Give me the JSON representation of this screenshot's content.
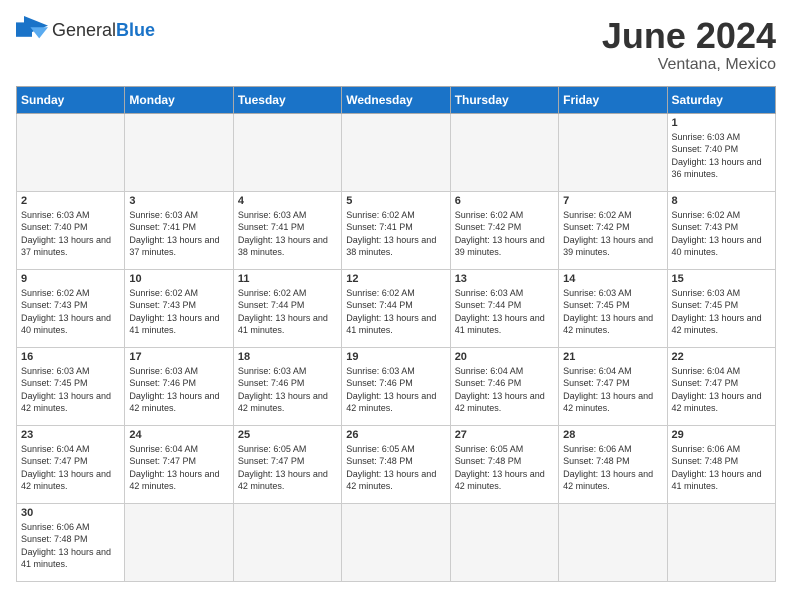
{
  "header": {
    "logo_general": "General",
    "logo_blue": "Blue",
    "month_year": "June 2024",
    "location": "Ventana, Mexico"
  },
  "weekdays": [
    "Sunday",
    "Monday",
    "Tuesday",
    "Wednesday",
    "Thursday",
    "Friday",
    "Saturday"
  ],
  "weeks": [
    [
      {
        "day": "",
        "text": "",
        "empty": true
      },
      {
        "day": "",
        "text": "",
        "empty": true
      },
      {
        "day": "",
        "text": "",
        "empty": true
      },
      {
        "day": "",
        "text": "",
        "empty": true
      },
      {
        "day": "",
        "text": "",
        "empty": true
      },
      {
        "day": "",
        "text": "",
        "empty": true
      },
      {
        "day": "1",
        "text": "Sunrise: 6:03 AM\nSunset: 7:40 PM\nDaylight: 13 hours and 36 minutes."
      }
    ],
    [
      {
        "day": "2",
        "text": "Sunrise: 6:03 AM\nSunset: 7:40 PM\nDaylight: 13 hours and 37 minutes."
      },
      {
        "day": "3",
        "text": "Sunrise: 6:03 AM\nSunset: 7:41 PM\nDaylight: 13 hours and 37 minutes."
      },
      {
        "day": "4",
        "text": "Sunrise: 6:03 AM\nSunset: 7:41 PM\nDaylight: 13 hours and 38 minutes."
      },
      {
        "day": "5",
        "text": "Sunrise: 6:02 AM\nSunset: 7:41 PM\nDaylight: 13 hours and 38 minutes."
      },
      {
        "day": "6",
        "text": "Sunrise: 6:02 AM\nSunset: 7:42 PM\nDaylight: 13 hours and 39 minutes."
      },
      {
        "day": "7",
        "text": "Sunrise: 6:02 AM\nSunset: 7:42 PM\nDaylight: 13 hours and 39 minutes."
      },
      {
        "day": "8",
        "text": "Sunrise: 6:02 AM\nSunset: 7:43 PM\nDaylight: 13 hours and 40 minutes."
      }
    ],
    [
      {
        "day": "9",
        "text": "Sunrise: 6:02 AM\nSunset: 7:43 PM\nDaylight: 13 hours and 40 minutes."
      },
      {
        "day": "10",
        "text": "Sunrise: 6:02 AM\nSunset: 7:43 PM\nDaylight: 13 hours and 41 minutes."
      },
      {
        "day": "11",
        "text": "Sunrise: 6:02 AM\nSunset: 7:44 PM\nDaylight: 13 hours and 41 minutes."
      },
      {
        "day": "12",
        "text": "Sunrise: 6:02 AM\nSunset: 7:44 PM\nDaylight: 13 hours and 41 minutes."
      },
      {
        "day": "13",
        "text": "Sunrise: 6:03 AM\nSunset: 7:44 PM\nDaylight: 13 hours and 41 minutes."
      },
      {
        "day": "14",
        "text": "Sunrise: 6:03 AM\nSunset: 7:45 PM\nDaylight: 13 hours and 42 minutes."
      },
      {
        "day": "15",
        "text": "Sunrise: 6:03 AM\nSunset: 7:45 PM\nDaylight: 13 hours and 42 minutes."
      }
    ],
    [
      {
        "day": "16",
        "text": "Sunrise: 6:03 AM\nSunset: 7:45 PM\nDaylight: 13 hours and 42 minutes."
      },
      {
        "day": "17",
        "text": "Sunrise: 6:03 AM\nSunset: 7:46 PM\nDaylight: 13 hours and 42 minutes."
      },
      {
        "day": "18",
        "text": "Sunrise: 6:03 AM\nSunset: 7:46 PM\nDaylight: 13 hours and 42 minutes."
      },
      {
        "day": "19",
        "text": "Sunrise: 6:03 AM\nSunset: 7:46 PM\nDaylight: 13 hours and 42 minutes."
      },
      {
        "day": "20",
        "text": "Sunrise: 6:04 AM\nSunset: 7:46 PM\nDaylight: 13 hours and 42 minutes."
      },
      {
        "day": "21",
        "text": "Sunrise: 6:04 AM\nSunset: 7:47 PM\nDaylight: 13 hours and 42 minutes."
      },
      {
        "day": "22",
        "text": "Sunrise: 6:04 AM\nSunset: 7:47 PM\nDaylight: 13 hours and 42 minutes."
      }
    ],
    [
      {
        "day": "23",
        "text": "Sunrise: 6:04 AM\nSunset: 7:47 PM\nDaylight: 13 hours and 42 minutes."
      },
      {
        "day": "24",
        "text": "Sunrise: 6:04 AM\nSunset: 7:47 PM\nDaylight: 13 hours and 42 minutes."
      },
      {
        "day": "25",
        "text": "Sunrise: 6:05 AM\nSunset: 7:47 PM\nDaylight: 13 hours and 42 minutes."
      },
      {
        "day": "26",
        "text": "Sunrise: 6:05 AM\nSunset: 7:48 PM\nDaylight: 13 hours and 42 minutes."
      },
      {
        "day": "27",
        "text": "Sunrise: 6:05 AM\nSunset: 7:48 PM\nDaylight: 13 hours and 42 minutes."
      },
      {
        "day": "28",
        "text": "Sunrise: 6:06 AM\nSunset: 7:48 PM\nDaylight: 13 hours and 42 minutes."
      },
      {
        "day": "29",
        "text": "Sunrise: 6:06 AM\nSunset: 7:48 PM\nDaylight: 13 hours and 41 minutes."
      }
    ],
    [
      {
        "day": "30",
        "text": "Sunrise: 6:06 AM\nSunset: 7:48 PM\nDaylight: 13 hours and 41 minutes."
      },
      {
        "day": "",
        "text": "",
        "empty": true
      },
      {
        "day": "",
        "text": "",
        "empty": true
      },
      {
        "day": "",
        "text": "",
        "empty": true
      },
      {
        "day": "",
        "text": "",
        "empty": true
      },
      {
        "day": "",
        "text": "",
        "empty": true
      },
      {
        "day": "",
        "text": "",
        "empty": true
      }
    ]
  ]
}
